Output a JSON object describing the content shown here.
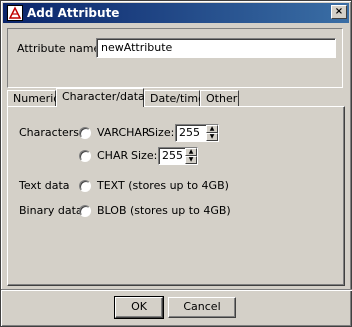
{
  "window": {
    "title": "Add Attribute",
    "close_glyph": "×"
  },
  "attribute_name": {
    "label": "Attribute name:",
    "value": "newAttribute"
  },
  "tabs": [
    {
      "label": "Numeric",
      "active": false
    },
    {
      "label": "Character/data",
      "active": true
    },
    {
      "label": "Date/time",
      "active": false
    },
    {
      "label": "Other",
      "active": false
    }
  ],
  "panel": {
    "characters_label": "Characters",
    "varchar": {
      "label": "VARCHAR",
      "size_label": "Size:",
      "size_value": "255",
      "selected": false
    },
    "char": {
      "label": "CHAR",
      "size_label": "Size:",
      "size_value": "255",
      "selected": false
    },
    "text_data_label": "Text data",
    "text": {
      "label": "TEXT (stores up to 4GB)",
      "selected": false
    },
    "binary_data_label": "Binary data",
    "blob": {
      "label": "BLOB (stores up to 4GB)",
      "selected": false
    }
  },
  "buttons": {
    "ok": "OK",
    "cancel": "Cancel"
  },
  "colors": {
    "titlebar_start": "#0a246a",
    "titlebar_end": "#3a6ea5",
    "face": "#d4d0c8"
  },
  "icons": {
    "title_icon": "app-icon",
    "close": "close-icon"
  }
}
